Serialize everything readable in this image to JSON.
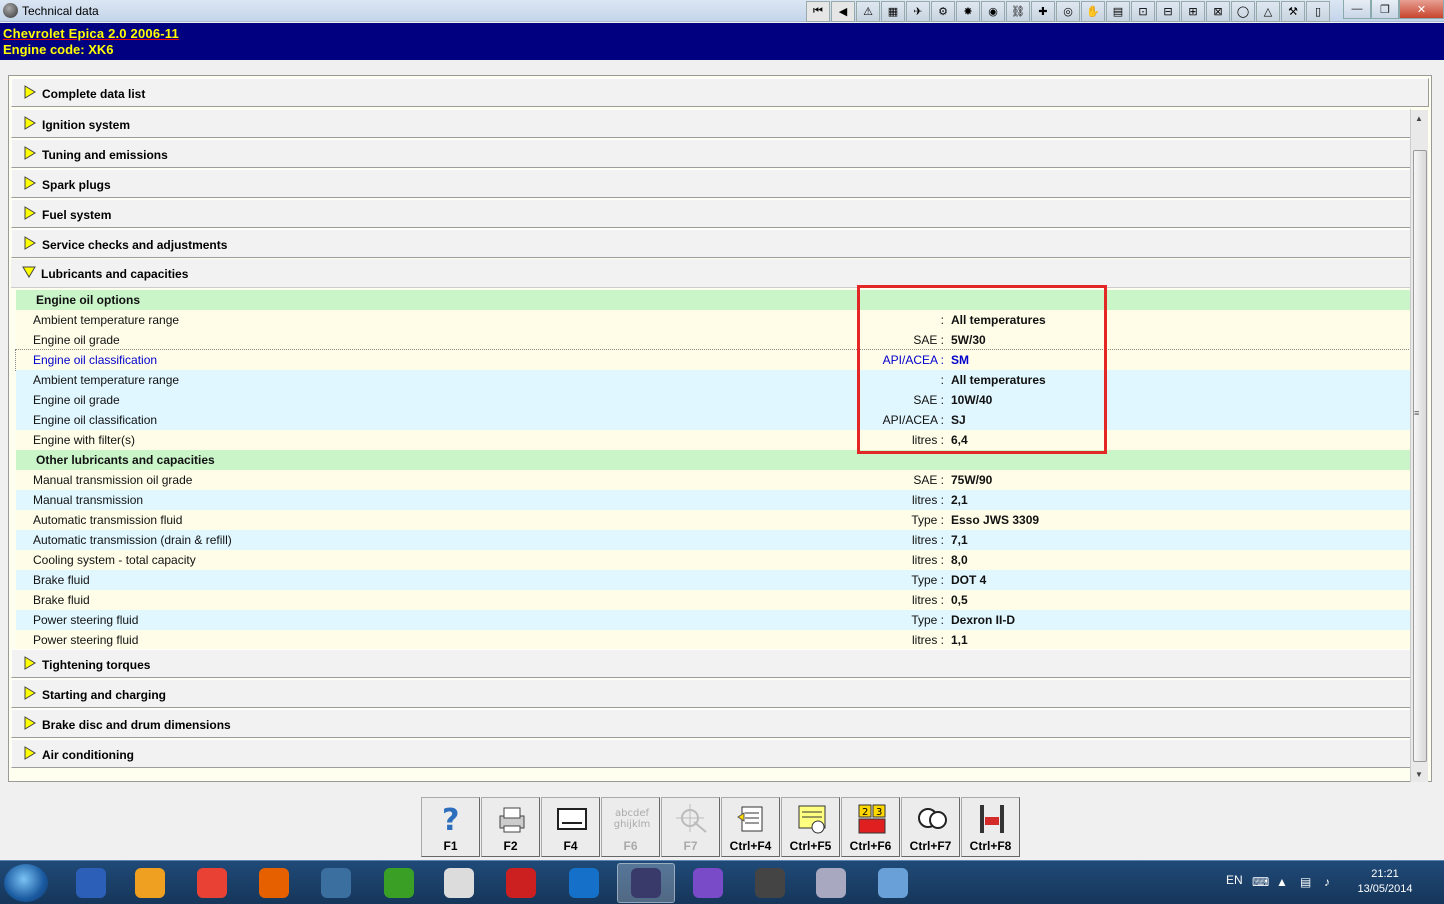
{
  "window": {
    "title": "Technical data",
    "toolbar_icons": [
      "first-icon",
      "prev-icon",
      "warning-icon",
      "flag-icon",
      "map-icon",
      "gear-wheel-icon",
      "tools-icon",
      "disc-icon",
      "lift-icon",
      "engine-icon",
      "tire-icon",
      "hand-icon",
      "oil-can-icon",
      "car-outline-icon",
      "car-front-icon",
      "car-side-icon",
      "car-rear-icon",
      "bulb-icon",
      "warning-outline-icon",
      "tool-icon",
      "gauge-icon"
    ]
  },
  "header": {
    "vehicle": "Chevrolet  Epica  2.0  2006-11",
    "engine": "Engine code: XK6"
  },
  "sections_top": [
    {
      "label": "Complete data list"
    },
    {
      "label": "Ignition system"
    },
    {
      "label": "Tuning and emissions"
    },
    {
      "label": "Spark plugs"
    },
    {
      "label": "Fuel system"
    },
    {
      "label": "Service checks and adjustments"
    }
  ],
  "expanded": {
    "label": "Lubricants and capacities",
    "rows": [
      {
        "type": "group",
        "name": "Engine oil options",
        "unit": "",
        "value": ""
      },
      {
        "type": "yellow",
        "name": "Ambient temperature range",
        "unit": ":",
        "value": "All temperatures"
      },
      {
        "type": "yellow",
        "name": "Engine oil grade",
        "unit": "SAE :",
        "value": "5W/30"
      },
      {
        "type": "sel",
        "name": "Engine oil classification",
        "unit": "API/ACEA :",
        "value": "SM"
      },
      {
        "type": "blue",
        "name": "Ambient temperature range",
        "unit": ":",
        "value": "All temperatures"
      },
      {
        "type": "blue",
        "name": "Engine oil grade",
        "unit": "SAE :",
        "value": "10W/40"
      },
      {
        "type": "blue",
        "name": "Engine oil classification",
        "unit": "API/ACEA :",
        "value": "SJ"
      },
      {
        "type": "yellow",
        "name": "Engine with filter(s)",
        "unit": "litres :",
        "value": "6,4"
      },
      {
        "type": "group",
        "name": "Other lubricants and capacities",
        "unit": "",
        "value": ""
      },
      {
        "type": "yellow",
        "name": "Manual transmission oil grade",
        "unit": "SAE :",
        "value": "75W/90"
      },
      {
        "type": "blue",
        "name": "Manual transmission",
        "unit": "litres :",
        "value": "2,1"
      },
      {
        "type": "yellow",
        "name": "Automatic transmission fluid",
        "unit": "Type :",
        "value": "Esso JWS 3309"
      },
      {
        "type": "blue",
        "name": "Automatic transmission (drain & refill)",
        "unit": "litres :",
        "value": "7,1"
      },
      {
        "type": "yellow",
        "name": "Cooling system - total capacity",
        "unit": "litres :",
        "value": "8,0"
      },
      {
        "type": "blue",
        "name": "Brake fluid",
        "unit": "Type :",
        "value": "DOT 4"
      },
      {
        "type": "yellow",
        "name": "Brake fluid",
        "unit": "litres :",
        "value": "0,5"
      },
      {
        "type": "blue",
        "name": "Power steering fluid",
        "unit": "Type :",
        "value": "Dexron II-D"
      },
      {
        "type": "yellow",
        "name": "Power steering fluid",
        "unit": "litres :",
        "value": "1,1"
      }
    ]
  },
  "sections_bottom": [
    {
      "label": "Tightening torques"
    },
    {
      "label": "Starting and charging"
    },
    {
      "label": "Brake disc and drum dimensions"
    },
    {
      "label": "Air conditioning"
    }
  ],
  "function_keys": [
    {
      "label": "F1",
      "icon": "help-icon",
      "enabled": true
    },
    {
      "label": "F2",
      "icon": "printer-icon",
      "enabled": true
    },
    {
      "label": "F4",
      "icon": "keyboard-icon",
      "enabled": true
    },
    {
      "label": "F6",
      "icon": "alphabet-icon",
      "enabled": false,
      "icon_text": "abcdef ghijklm"
    },
    {
      "label": "F7",
      "icon": "crosshair-icon",
      "enabled": false
    },
    {
      "label": "Ctrl+F4",
      "icon": "notes-icon",
      "enabled": true
    },
    {
      "label": "Ctrl+F5",
      "icon": "list-add-icon",
      "enabled": true
    },
    {
      "label": "Ctrl+F6",
      "icon": "schedule-icon",
      "enabled": true,
      "icon_text": "2 3"
    },
    {
      "label": "Ctrl+F7",
      "icon": "gauges-icon",
      "enabled": true
    },
    {
      "label": "Ctrl+F8",
      "icon": "car-lift-icon",
      "enabled": true
    }
  ],
  "taskbar": {
    "apps": [
      "save-icon",
      "winamp-icon",
      "chrome-icon",
      "firefox-icon",
      "kmplayer-icon",
      "utorrent-icon",
      "calculator-icon",
      "media-icon",
      "teamviewer-icon",
      "technical-data-icon",
      "viber-icon",
      "video-editor-icon",
      "remote-icon",
      "paint-icon"
    ],
    "language": "EN",
    "time": "21:21",
    "date": "13/05/2014"
  },
  "colors": {
    "header_bg": "#000080",
    "header_text": "#ffff00",
    "group_row": "#c9f5c9",
    "blue_row": "#e0f7ff",
    "yellow_row": "#fffde8",
    "highlight_box": "#e32626"
  }
}
